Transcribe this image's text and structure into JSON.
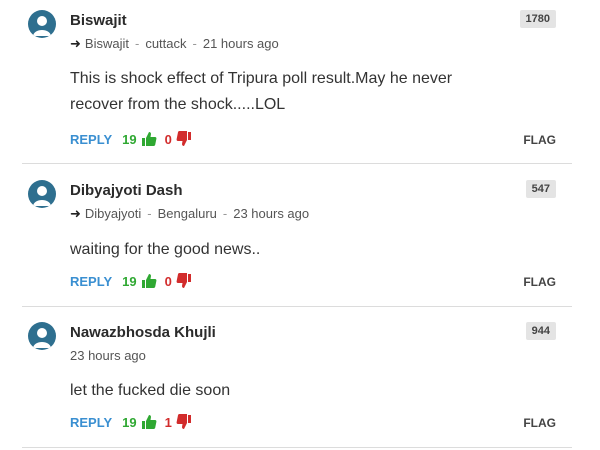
{
  "labels": {
    "reply": "REPLY",
    "flag": "FLAG"
  },
  "colors": {
    "reply": "#3a8fd1",
    "upvote": "#2fa832",
    "downvote": "#d22c2c",
    "avatar": "#2e6f8f"
  },
  "comments": [
    {
      "author": "Biswajit",
      "reply_to": "Biswajit",
      "location": "cuttack",
      "time": "21 hours ago",
      "badge": "1780",
      "text_lines": [
        "This is shock effect of Tripura poll result.May he never",
        "recover from the shock.....LOL"
      ],
      "upvotes": "19",
      "downvotes": "0"
    },
    {
      "author": "Dibyajyoti Dash",
      "reply_to": "Dibyajyoti",
      "location": "Bengaluru",
      "time": "23 hours ago",
      "badge": "547",
      "text_lines": [
        "waiting for the good news.."
      ],
      "upvotes": "19",
      "downvotes": "0"
    },
    {
      "author": "Nawazbhosda Khujli",
      "time": "23 hours ago",
      "badge": "944",
      "text_lines": [
        "let the fucked die soon"
      ],
      "upvotes": "19",
      "downvotes": "1"
    }
  ]
}
